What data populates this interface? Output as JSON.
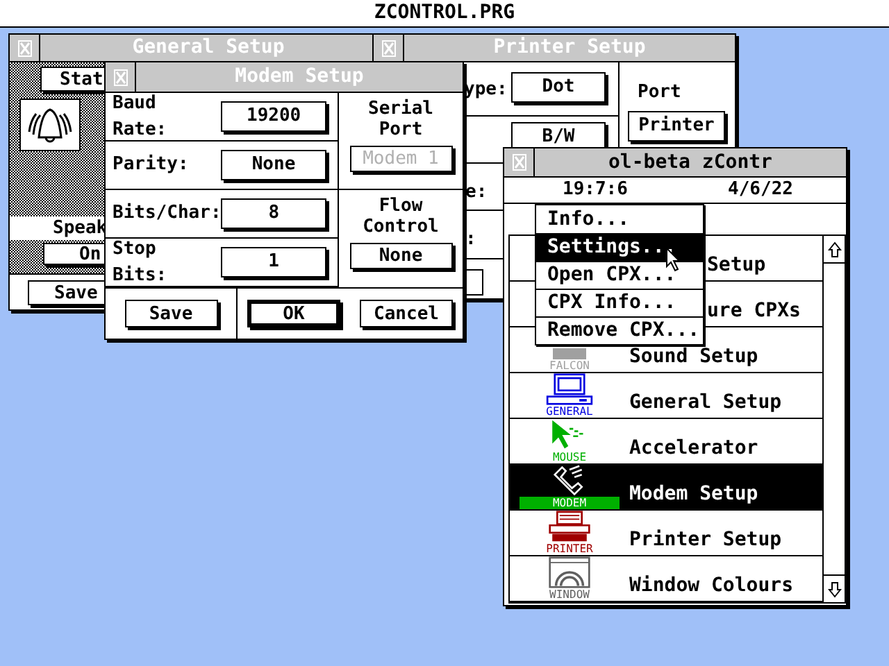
{
  "menu_bar": {
    "title": "ZCONTROL.PRG"
  },
  "general_setup": {
    "title": "General Setup",
    "active": false,
    "status_button": "Stat",
    "speaker_label": "Speak",
    "speaker_button": "On",
    "save_button": "Save"
  },
  "printer_setup": {
    "title": "Printer Setup",
    "active": false,
    "type_label": "ype:",
    "type_button": "Dot",
    "port_label": "Port",
    "port_button": "Printer",
    "color_button": "B/W",
    "label_2": "e:",
    "label_3": ":",
    "option_checked": false
  },
  "modem_setup": {
    "title": "Modem Setup",
    "active": false,
    "fields": [
      {
        "label": "Baud Rate:",
        "value": "19200"
      },
      {
        "label": "Parity:",
        "value": "None"
      },
      {
        "label": "Bits/Char:",
        "value": "8"
      },
      {
        "label": "Stop Bits:",
        "value": "1"
      }
    ],
    "serial_port": {
      "label": "Serial Port",
      "value": "Modem 1",
      "disabled": true
    },
    "flow_control": {
      "label": "Flow Control",
      "value": "None",
      "disabled": false
    },
    "buttons": [
      {
        "label": "Save",
        "default": false
      },
      {
        "label": "OK",
        "default": true
      },
      {
        "label": "Cancel",
        "default": false
      }
    ]
  },
  "zcontrol": {
    "title": "ol-beta  zContr",
    "active": true,
    "time": "19:7:6",
    "date": "4/6/22",
    "items": [
      {
        "label": "Setup",
        "kind": "covered",
        "selected": false
      },
      {
        "label": "ure CPXs",
        "kind": "covered",
        "selected": false
      },
      {
        "label": "Sound Setup",
        "kind": "falcon",
        "icon_label": "FALCON",
        "color": "#a0a0a0",
        "selected": false
      },
      {
        "label": "General Setup",
        "kind": "general",
        "icon_label": "GENERAL",
        "color": "#0000e0",
        "selected": false
      },
      {
        "label": "Accelerator",
        "kind": "mouse",
        "icon_label": "MOUSE",
        "color": "#00b000",
        "selected": false
      },
      {
        "label": "Modem Setup",
        "kind": "modem",
        "icon_label": "MODEM",
        "color": "#00b000",
        "selected": true
      },
      {
        "label": "Printer Setup",
        "kind": "printer",
        "icon_label": "PRINTER",
        "color": "#a00000",
        "selected": false
      },
      {
        "label": "Window Colours",
        "kind": "window",
        "icon_label": "WINDOW",
        "color": "#606060",
        "selected": false
      }
    ],
    "menu": [
      {
        "label": "Info...",
        "selected": false
      },
      {
        "label": "Settings...",
        "selected": true
      },
      {
        "label": "Open CPX...",
        "selected": false
      },
      {
        "label": "CPX Info...",
        "selected": false
      },
      {
        "label": "Remove CPX...",
        "selected": false
      }
    ]
  }
}
